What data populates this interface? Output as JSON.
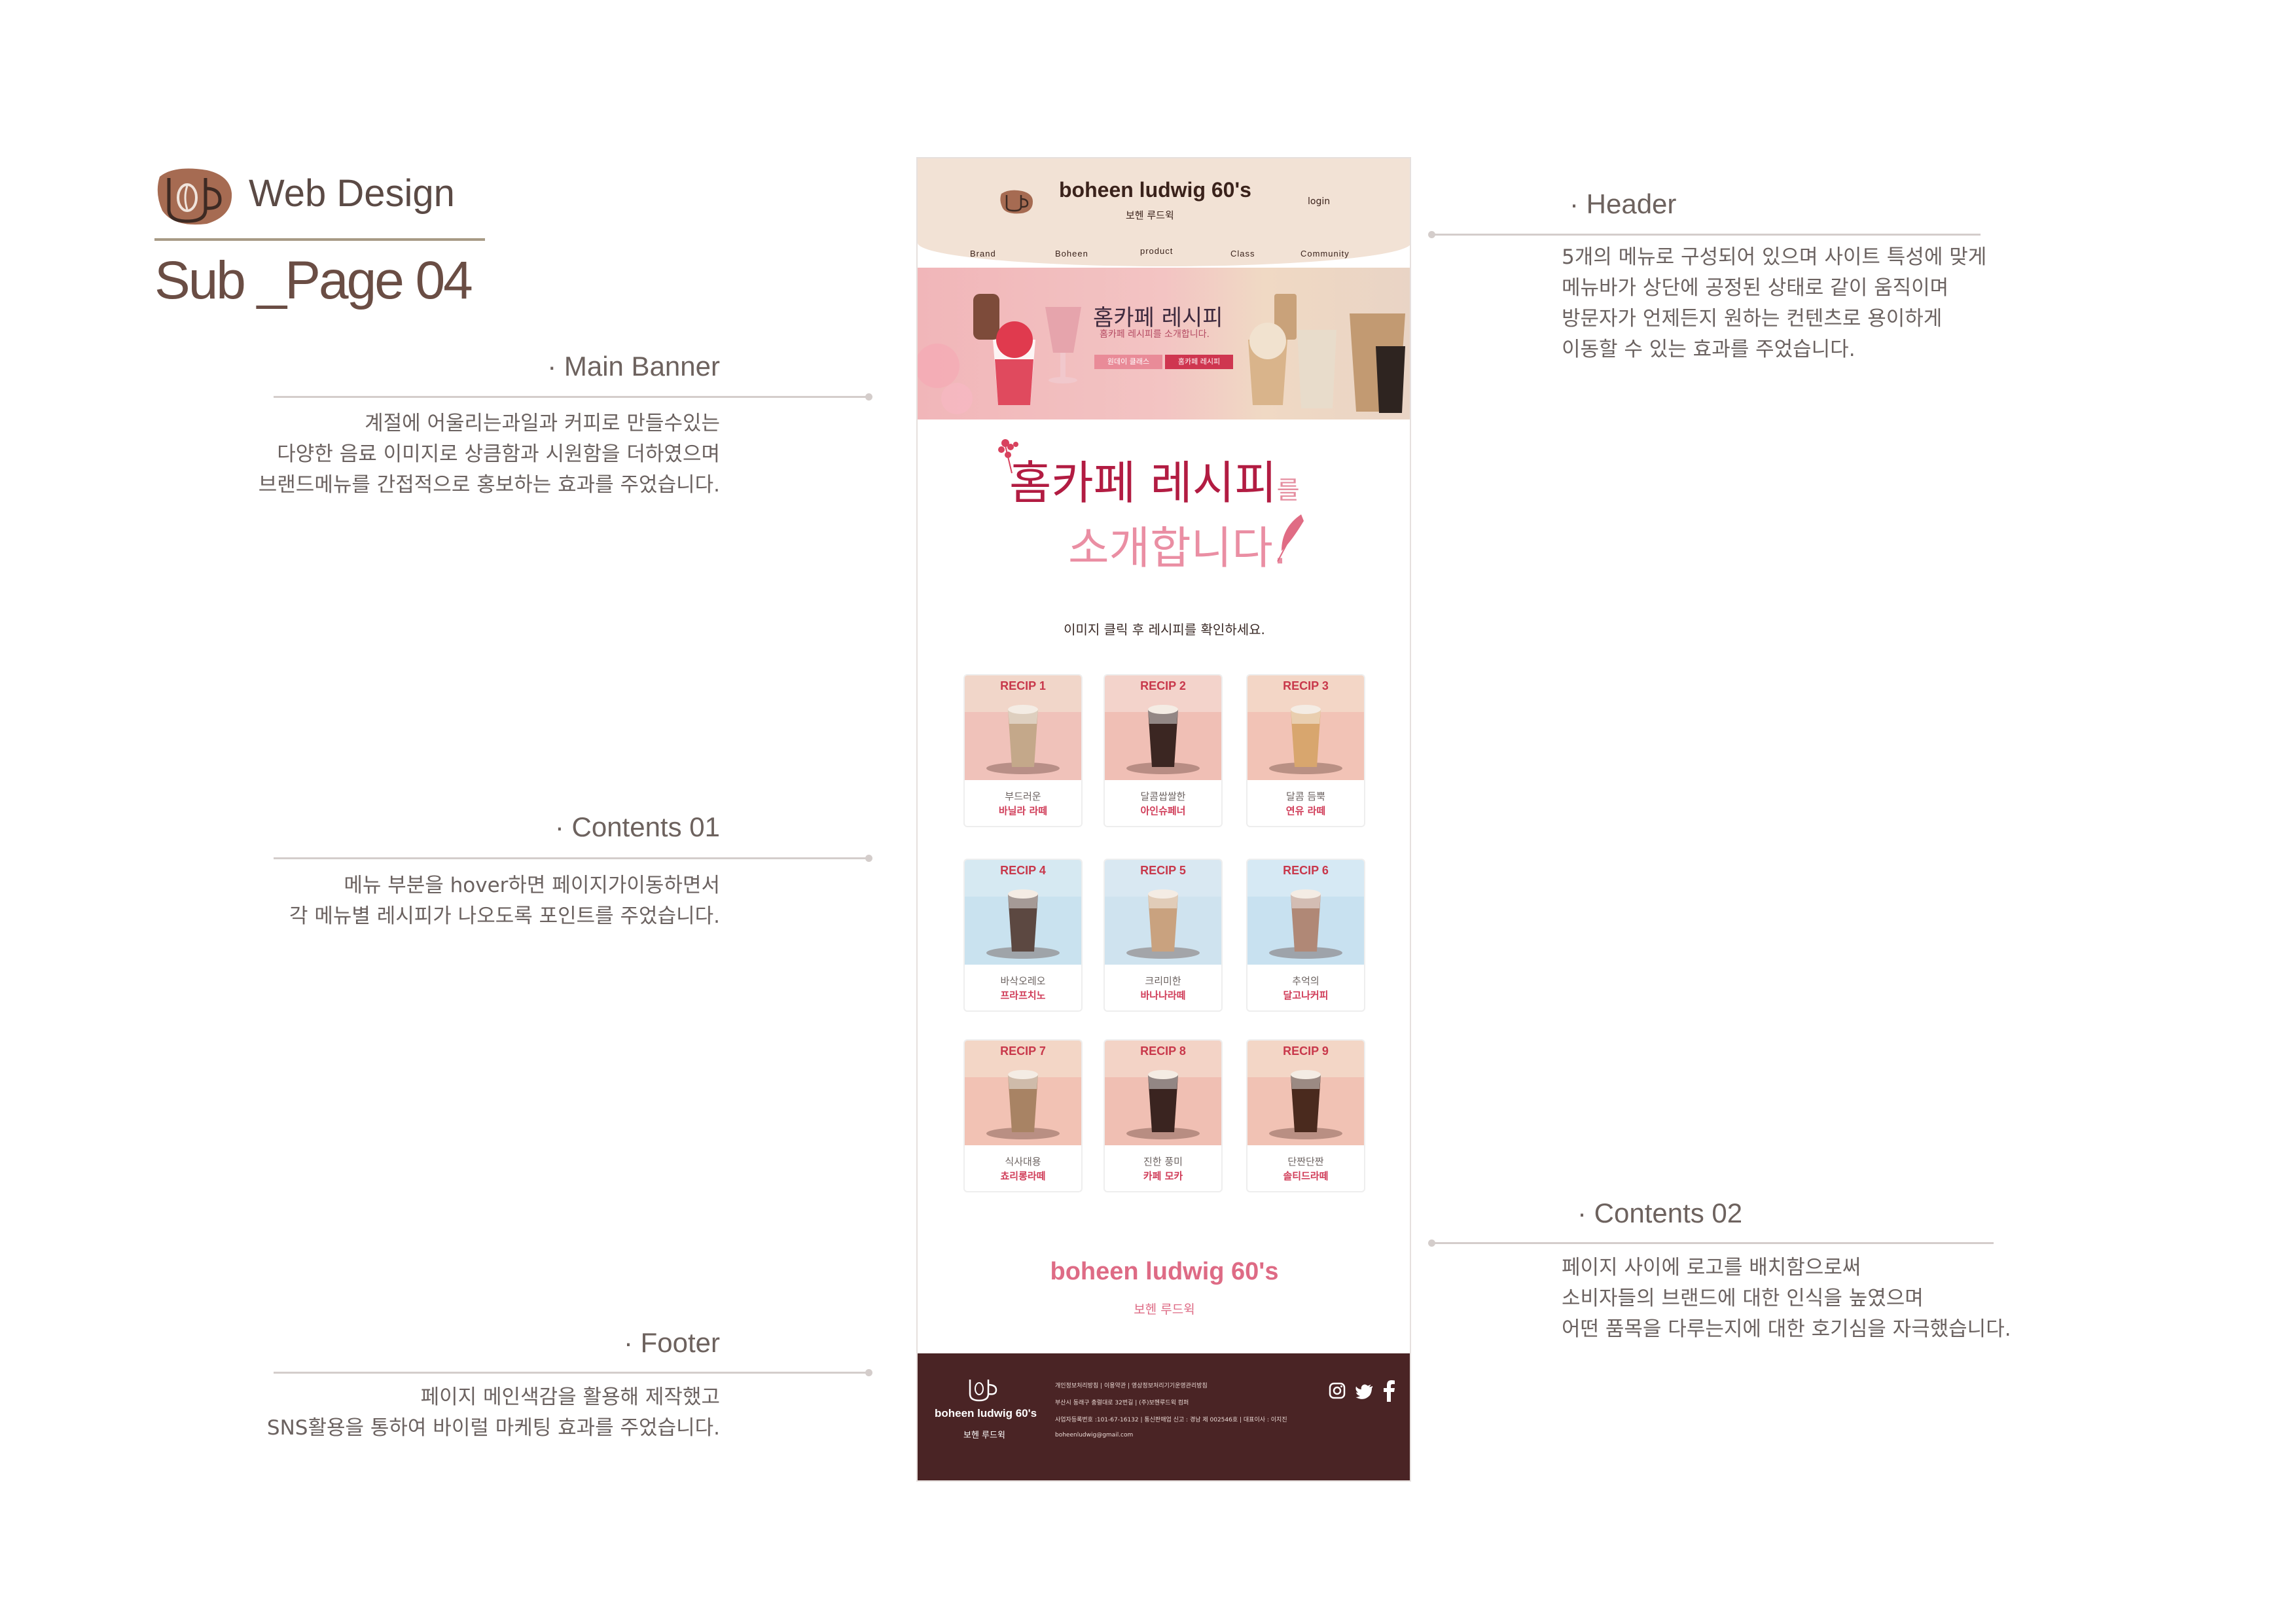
{
  "title": {
    "heading": "Web Design",
    "subheading": "Sub _Page 04"
  },
  "annotations": {
    "header": {
      "title": "· Header",
      "text": "5개의 메뉴로 구성되어 있으며 사이트 특성에 맞게\n메뉴바가 상단에 공정된 상태로 같이 움직이며\n방문자가 언제든지 원하는 컨텐츠로 용이하게\n이동할 수 있는 효과를 주었습니다."
    },
    "main_banner": {
      "title": "· Main Banner",
      "text": "계절에 어울리는과일과 커피로 만들수있는\n다양한 음료 이미지로 상큼함과 시원함을 더하였으며\n브랜드메뉴를 간접적으로 홍보하는 효과를 주었습니다."
    },
    "contents01": {
      "title": "· Contents 01",
      "text": "메뉴 부분을 hover하면 페이지가이동하면서\n각 메뉴별 레시피가 나오도록 포인트를 주었습니다."
    },
    "contents02": {
      "title": "· Contents 02",
      "text": "페이지 사이에 로고를 배치함으로써\n소비자들의 브랜드에 대한 인식을 높였으며\n어떤 품목을 다루는지에 대한 호기심을 자극했습니다."
    },
    "footer": {
      "title": "· Footer",
      "text": "페이지 메인색감을 활용해 제작했고\nSNS활용을 통하여 바이럴 마케팅 효과를 주었습니다."
    }
  },
  "site": {
    "brand": "boheen ludwig 60's",
    "brand_kr": "보헨 루드윅",
    "login": "login",
    "nav": [
      "Brand",
      "Boheen",
      "product",
      "Class",
      "Community"
    ],
    "banner": {
      "title": "홈카페 레시피",
      "sub": "홈카페 레시피를 소개합니다.",
      "btn1": "원데이 클래스",
      "btn2": "홈카페 레시피"
    },
    "headline_a": "홈카페 레시피",
    "headline_b": "를",
    "headline_c": "소개합니다.",
    "instruction": "이미지 클릭 후 레시피를 확인하세요.",
    "recipes": [
      {
        "label": "RECIP 1",
        "desc": "부드러운",
        "name": "바닐라 라떼"
      },
      {
        "label": "RECIP 2",
        "desc": "달콤쌉쌀한",
        "name": "아인슈페너"
      },
      {
        "label": "RECIP 3",
        "desc": "달콤 듬뿍",
        "name": "연유 라떼"
      },
      {
        "label": "RECIP 4",
        "desc": "바삭오레오",
        "name": "프라프치노"
      },
      {
        "label": "RECIP 5",
        "desc": "크리미한",
        "name": "바나나라떼"
      },
      {
        "label": "RECIP 6",
        "desc": "추억의",
        "name": "달고나커피"
      },
      {
        "label": "RECIP 7",
        "desc": "식사대용",
        "name": "쵸리롱라떼"
      },
      {
        "label": "RECIP 8",
        "desc": "진한 풍미",
        "name": "카페 모카"
      },
      {
        "label": "RECIP 9",
        "desc": "단짠단짠",
        "name": "솔티드라떼"
      }
    ],
    "footer": {
      "links": "개인정보처리방침 | 이용약관 | 영상정보처리기기운영관리방침",
      "address": "부산시 동래구 충렬대로 32번길 | (주)보헨루드윅 컴퍼",
      "biz": "사업자등록번호 :101-67-16132 | 통신판매업 신고 : 경남 제 002546호 | 대표이사 : 이지진",
      "email": "boheenludwig@gmail.com"
    }
  },
  "colors": {
    "accent": "#b21c42",
    "footer_bg": "#4a2425",
    "header_bg": "#f2e2d5"
  },
  "icons": [
    "coffee-cup-logo-icon",
    "instagram-icon",
    "twitter-icon",
    "facebook-icon",
    "flower-icon",
    "feather-icon"
  ]
}
